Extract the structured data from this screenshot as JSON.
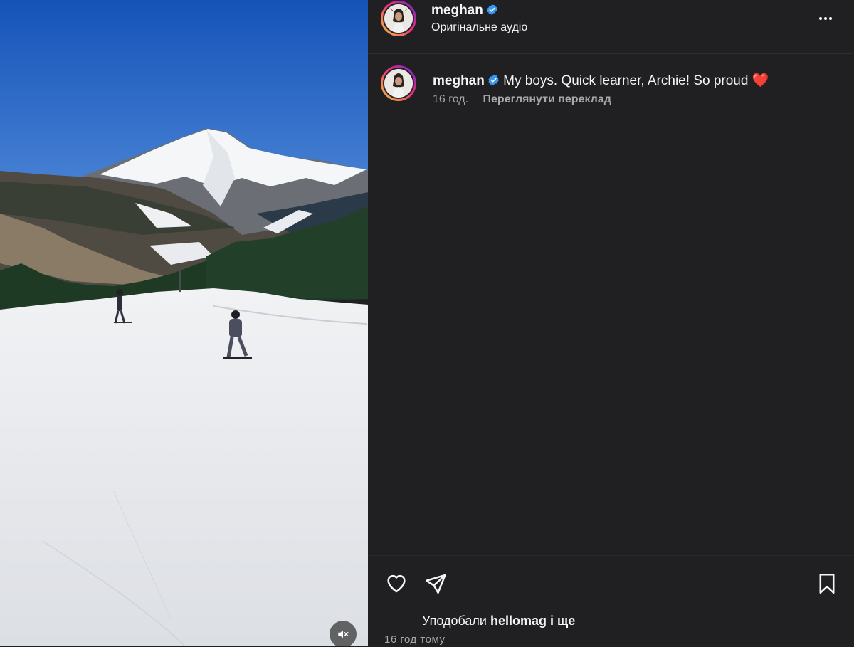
{
  "post": {
    "username": "meghan",
    "audio_label": "Оригінальне аудіо",
    "caption": "My boys. Quick learner, Archie! So proud",
    "caption_emoji": "❤️",
    "posted_ago": "16 год.",
    "translate_label": "Переглянути переклад",
    "likes_prefix": "Уподобали",
    "likes_user": "hellomag",
    "likes_suffix": "і ще",
    "timestamp": "16 год тому"
  },
  "icons": {
    "verified": "verified-badge-icon",
    "more": "more-options-icon",
    "like": "heart-icon",
    "share": "send-icon",
    "save": "bookmark-icon",
    "mute": "speaker-muted-icon"
  },
  "colors": {
    "panel_bg": "#202022",
    "text_primary": "#f5f5f5",
    "text_secondary": "#a8a8a8",
    "verified_blue": "#3897f0",
    "heart_red": "#ed4956"
  }
}
